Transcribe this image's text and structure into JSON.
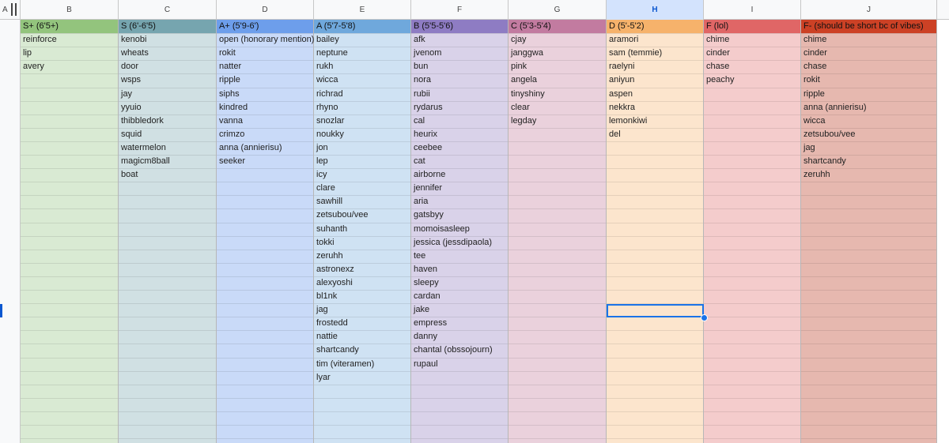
{
  "sheet": {
    "column_letters": {
      "A": "A",
      "B": "B",
      "C": "C",
      "D": "D",
      "E": "E",
      "F": "F",
      "G": "G",
      "H": "H",
      "I": "I",
      "J": "J"
    },
    "selected_column": "H",
    "selection_color": "#1a73e8"
  },
  "tiers": [
    {
      "letter": "B",
      "label": "S+ (6'5+)",
      "header_color": "#93c47d",
      "fill_color": "#d9ead3",
      "names": [
        "reinforce",
        "lip",
        "avery"
      ]
    },
    {
      "letter": "C",
      "label": "S (6'-6'5)",
      "header_color": "#76a5af",
      "fill_color": "#d0e0e3",
      "names": [
        "kenobi",
        "wheats",
        "door",
        "wsps",
        "jay",
        "yyuio",
        "thibbledork",
        "squid",
        "watermelon",
        "magicm8ball",
        "boat"
      ]
    },
    {
      "letter": "D",
      "label": "A+ (5'9-6')",
      "header_color": "#6d9eeb",
      "fill_color": "#c9daf8",
      "names": [
        "open (honorary mention)",
        "rokit",
        "natter",
        "ripple",
        "siphs",
        "kindred",
        "vanna",
        "crimzo",
        "anna (annierisu)",
        "seeker"
      ]
    },
    {
      "letter": "E",
      "label": "A (5'7-5'8)",
      "header_color": "#6fa8dc",
      "fill_color": "#cfe2f3",
      "names": [
        "bailey",
        "neptune",
        "rukh",
        "wicca",
        "richrad",
        "rhyno",
        "snozlar",
        "noukky",
        "jon",
        "lep",
        "icy",
        "clare",
        "sawhill",
        "zetsubou/vee",
        "suhanth",
        "tokki",
        "zeruhh",
        "astronexz",
        "alexyoshi",
        "bl1nk",
        "jag",
        "frostedd",
        "nattie",
        "shartcandy",
        "tim (viteramen)",
        "lyar"
      ]
    },
    {
      "letter": "F",
      "label": "B (5'5-5'6)",
      "header_color": "#8e7cc3",
      "fill_color": "#d9d2e9",
      "names": [
        "afk",
        "jvenom",
        "bun",
        "nora",
        "rubii",
        "rydarus",
        "cal",
        "heurix",
        "ceebee",
        "cat",
        "airborne",
        "jennifer",
        "aria",
        "gatsbyy",
        "momoisasleep",
        "jessica (jessdipaola)",
        "tee",
        "haven",
        "sleepy",
        "cardan",
        "jake",
        "empress",
        "danny",
        "chantal (obssojourn)",
        "rupaul"
      ]
    },
    {
      "letter": "G",
      "label": "C (5'3-5'4)",
      "header_color": "#c27ba0",
      "fill_color": "#ead1dc",
      "names": [
        "cjay",
        "janggwa",
        "pink",
        "angela",
        "tinyshiny",
        "clear",
        "legday"
      ]
    },
    {
      "letter": "H",
      "label": "D (5'-5'2)",
      "header_color": "#f6b26b",
      "fill_color": "#fce5cd",
      "names": [
        "aramori",
        "sam (temmie)",
        "raelyni",
        "aniyun",
        "aspen",
        "nekkra",
        "lemonkiwi",
        "del"
      ]
    },
    {
      "letter": "I",
      "label": "F (lol)",
      "header_color": "#e06666",
      "fill_color": "#f4cccc",
      "names": [
        "chime",
        "cinder",
        "chase",
        "peachy"
      ]
    },
    {
      "letter": "J",
      "label": "F- (should be short bc of vibes)",
      "header_color": "#cc4125",
      "fill_color": "#e6b8af",
      "names": [
        "chime",
        "cinder",
        "chase",
        "rokit",
        "ripple",
        "anna (annierisu)",
        "wicca",
        "zetsubou/vee",
        "jag",
        "shartcandy",
        "zeruhh"
      ]
    }
  ]
}
